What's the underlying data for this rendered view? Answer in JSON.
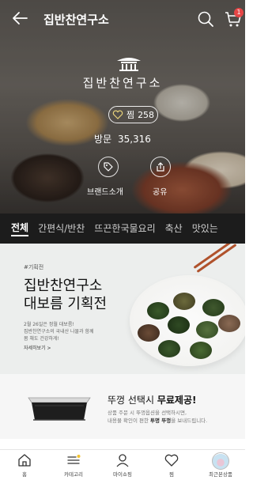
{
  "header": {
    "title": "집반찬연구소",
    "cart_count": "1"
  },
  "brand": {
    "name": "집반찬연구소",
    "like_label": "찜",
    "like_count": "258",
    "visit_label": "방문",
    "visit_count": "35,316",
    "brand_intro_label": "브랜드소개",
    "share_label": "공유"
  },
  "tabs": [
    "전체",
    "간편식/반찬",
    "뜨끈한국물요리",
    "축산",
    "맛있는"
  ],
  "banner": {
    "tag": "#기획전",
    "title_line1": "집반찬연구소",
    "title_line2": "대보름 기획전",
    "desc_line1": "2월 26일은 정월 대보름!",
    "desc_line2": "집반찬연구소의 국내산 나물과 함께",
    "desc_line3": "몸 채도 건강하게!",
    "more": "자세히보기 >"
  },
  "promo": {
    "title_prefix": "뚜껑 선택시 ",
    "title_bold": "무료제공!",
    "desc_line1": "상품 주문 시 뚜껑옵션을 선택하시면,",
    "desc_line2_prefix": "내용물 확인이 편한 ",
    "desc_line2_bold": "투명 뚜껑",
    "desc_line2_suffix": "을 보내드립니다."
  },
  "bottom_nav": [
    {
      "label": "홈",
      "icon": "home-icon"
    },
    {
      "label": "카테고리",
      "icon": "menu-icon"
    },
    {
      "label": "마이쇼핑",
      "icon": "user-icon"
    },
    {
      "label": "찜",
      "icon": "heart-icon"
    },
    {
      "label": "최근본상품",
      "icon": "recent-product-icon"
    }
  ],
  "colors": {
    "tab_bar": "#1c1c1c",
    "badge": "#e64646",
    "category_dot": "#f2c230"
  }
}
